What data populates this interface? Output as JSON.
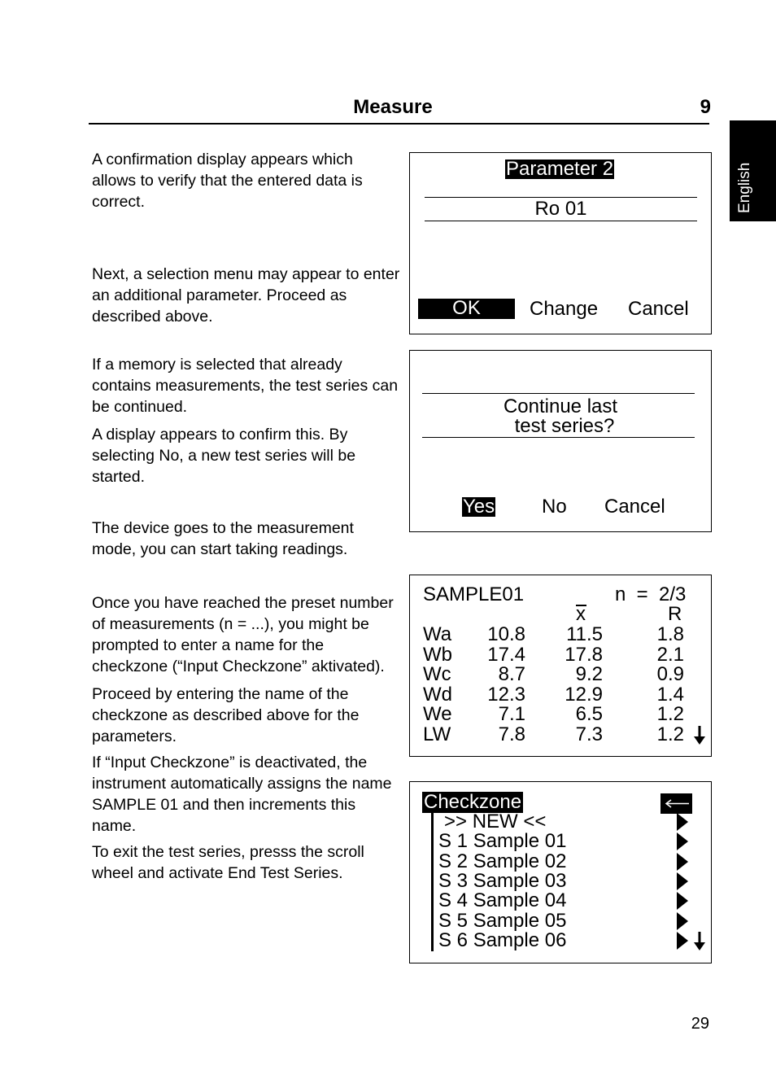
{
  "header": {
    "title": "Measure",
    "chapter_number": "9"
  },
  "side_tab": {
    "label": "English"
  },
  "paragraphs": {
    "p1": "A confirmation display appears which allows to verify that the entered data is correct.",
    "p2": "Next, a selection menu may appear to enter an additional parameter. Proceed as described above.",
    "p3": "If a memory is selected that already contains measurements, the test series can be continued.",
    "p4": "A display appears to confirm this. By selecting No, a new test series will be started.",
    "p5": "The device goes to the measurement mode, you can start taking readings.",
    "p6": "Once you have reached the preset number of measurements (n = ...), you might be prompted to enter a name for the checkzone (“Input Checkzone” aktivated).",
    "p7": "Proceed by entering the name of the checkzone as described above for the parameters.",
    "p8": "If “Input Checkzone” is deactivated, the instrument automatically assigns the name SAMPLE 01 and then increments this name.",
    "p9": "To exit the test series, presss the scroll wheel and activate End Test Series."
  },
  "screen_parameter": {
    "title": "Parameter 2",
    "value": "Ro 01",
    "buttons": [
      {
        "label": "OK",
        "selected": true
      },
      {
        "label": "Change",
        "selected": false
      },
      {
        "label": "Cancel",
        "selected": false
      }
    ]
  },
  "screen_continue": {
    "question_line1": "Continue last",
    "question_line2": "test series?",
    "buttons": [
      {
        "label": "Yes",
        "selected": true
      },
      {
        "label": "No",
        "selected": false
      },
      {
        "label": "Cancel",
        "selected": false
      }
    ]
  },
  "screen_results": {
    "sample_name": "SAMPLE01",
    "count_label": "n  =  2/3",
    "columns": [
      "",
      "",
      "x̄",
      "R"
    ],
    "mean_header": "x",
    "range_header": "R",
    "rows": [
      {
        "label": "Wa",
        "value": "10.8",
        "mean": "11.5",
        "range": "1.8"
      },
      {
        "label": "Wb",
        "value": "17.4",
        "mean": "17.8",
        "range": "2.1"
      },
      {
        "label": "Wc",
        "value": "8.7",
        "mean": "9.2",
        "range": "0.9"
      },
      {
        "label": "Wd",
        "value": "12.3",
        "mean": "12.9",
        "range": "1.4"
      },
      {
        "label": "We",
        "value": "7.1",
        "mean": "6.5",
        "range": "1.2"
      },
      {
        "label": "LW",
        "value": "7.8",
        "mean": "7.3",
        "range": "1.2"
      }
    ],
    "scroll_icon": "arrow-down-icon"
  },
  "screen_checkzone": {
    "title": "Checkzone",
    "back_icon": "back-arrow-icon",
    "items": [
      ">> NEW <<",
      "S 1 Sample 01",
      "S 2 Sample 02",
      "S 3 Sample 03",
      "S 4 Sample 04",
      "S 5 Sample 05",
      "S 6 Sample 06"
    ],
    "scroll_icon": "arrow-down-icon"
  },
  "footer": {
    "page_number": "29"
  }
}
